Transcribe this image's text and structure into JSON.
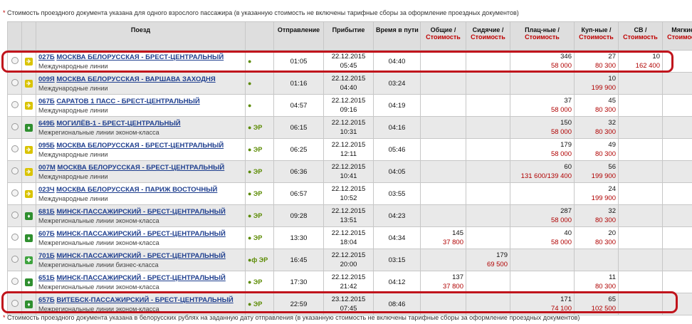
{
  "notes": {
    "top_star": "*",
    "top": "Стоимость проездного документа указана для одного взрослого пассажира (в указанную стоимость не включены тарифные сборы за оформление проездных документов)",
    "bottom_star": "*",
    "bottom": "Стоимость проездного документа указана в белорусских рублях на заданную дату отправления (в указанную стоимость не включены тарифные сборы за оформление проездных документов)"
  },
  "headers": {
    "train": "Поезд",
    "departure": "Отправление",
    "arrival": "Прибытие",
    "duration": "Время в пути",
    "common": "Общие /",
    "seated": "Сидячие /",
    "platz": "Плац-ные /",
    "coupe": "Куп-ные /",
    "sv": "СВ /",
    "soft": "Мягкие /",
    "cost": "Стоимость"
  },
  "colors": {
    "highlight": "#c0141c",
    "link": "#1f3f8f",
    "price": "#b00000"
  },
  "rows": [
    {
      "icon": "int",
      "num": "027Б",
      "name": "МОСКВА БЕЛОРУССКАЯ - БРЕСТ-ЦЕНТРАЛЬНЫЙ",
      "sub": "Международные линии",
      "svc": "●",
      "dep": "01:05",
      "arr_date": "22.12.2015",
      "arr_time": "05:45",
      "dur": "04:40",
      "common_s": "",
      "common_p": "",
      "seat_s": "",
      "seat_p": "",
      "platz_s": "346",
      "platz_p": "58 000",
      "coupe_s": "27",
      "coupe_p": "80 300",
      "sv_s": "10",
      "sv_p": "162 400",
      "soft_s": "",
      "soft_p": ""
    },
    {
      "icon": "int",
      "num": "009Я",
      "name": "МОСКВА БЕЛОРУССКАЯ - ВАРШАВА ЗАХОДНЯ",
      "sub": "Международные линии",
      "svc": "●",
      "dep": "01:16",
      "arr_date": "22.12.2015",
      "arr_time": "04:40",
      "dur": "03:24",
      "common_s": "",
      "common_p": "",
      "seat_s": "",
      "seat_p": "",
      "platz_s": "",
      "platz_p": "",
      "coupe_s": "10",
      "coupe_p": "199 900",
      "sv_s": "",
      "sv_p": "",
      "soft_s": "",
      "soft_p": ""
    },
    {
      "icon": "int",
      "num": "067Б",
      "name": "САРАТОВ 1 ПАСС - БРЕСТ-ЦЕНТРАЛЬНЫЙ",
      "sub": "Международные линии",
      "svc": "●",
      "dep": "04:57",
      "arr_date": "22.12.2015",
      "arr_time": "09:16",
      "dur": "04:19",
      "common_s": "",
      "common_p": "",
      "seat_s": "",
      "seat_p": "",
      "platz_s": "37",
      "platz_p": "58 000",
      "coupe_s": "45",
      "coupe_p": "80 300",
      "sv_s": "",
      "sv_p": "",
      "soft_s": "",
      "soft_p": ""
    },
    {
      "icon": "reg",
      "num": "649Б",
      "name": "МОГИЛЁВ-1 - БРЕСТ-ЦЕНТРАЛЬНЫЙ",
      "sub": "Межрегиональные линии эконом-класса",
      "svc": "● ЭР",
      "dep": "06:15",
      "arr_date": "22.12.2015",
      "arr_time": "10:31",
      "dur": "04:16",
      "common_s": "",
      "common_p": "",
      "seat_s": "",
      "seat_p": "",
      "platz_s": "150",
      "platz_p": "58 000",
      "coupe_s": "32",
      "coupe_p": "80 300",
      "sv_s": "",
      "sv_p": "",
      "soft_s": "",
      "soft_p": ""
    },
    {
      "icon": "int",
      "num": "095Б",
      "name": "МОСКВА БЕЛОРУССКАЯ - БРЕСТ-ЦЕНТРАЛЬНЫЙ",
      "sub": "Международные линии",
      "svc": "● ЭР",
      "dep": "06:25",
      "arr_date": "22.12.2015",
      "arr_time": "12:11",
      "dur": "05:46",
      "common_s": "",
      "common_p": "",
      "seat_s": "",
      "seat_p": "",
      "platz_s": "179",
      "platz_p": "58 000",
      "coupe_s": "49",
      "coupe_p": "80 300",
      "sv_s": "",
      "sv_p": "",
      "soft_s": "",
      "soft_p": ""
    },
    {
      "icon": "int",
      "num": "007М",
      "name": "МОСКВА БЕЛОРУССКАЯ - БРЕСТ-ЦЕНТРАЛЬНЫЙ",
      "sub": "Международные линии",
      "svc": "● ЭР",
      "dep": "06:36",
      "arr_date": "22.12.2015",
      "arr_time": "10:41",
      "dur": "04:05",
      "common_s": "",
      "common_p": "",
      "seat_s": "",
      "seat_p": "",
      "platz_s": "60",
      "platz_p": "131 600/139 400",
      "coupe_s": "56",
      "coupe_p": "199 900",
      "sv_s": "",
      "sv_p": "",
      "soft_s": "",
      "soft_p": ""
    },
    {
      "icon": "int",
      "num": "023Ч",
      "name": "МОСКВА БЕЛОРУССКАЯ - ПАРИЖ ВОСТОЧНЫЙ",
      "sub": "Международные линии",
      "svc": "● ЭР",
      "dep": "06:57",
      "arr_date": "22.12.2015",
      "arr_time": "10:52",
      "dur": "03:55",
      "common_s": "",
      "common_p": "",
      "seat_s": "",
      "seat_p": "",
      "platz_s": "",
      "platz_p": "",
      "coupe_s": "24",
      "coupe_p": "199 900",
      "sv_s": "",
      "sv_p": "",
      "soft_s": "",
      "soft_p": ""
    },
    {
      "icon": "reg",
      "num": "681Б",
      "name": "МИНСК-ПАССАЖИРСКИЙ - БРЕСТ-ЦЕНТРАЛЬНЫЙ",
      "sub": "Межрегиональные линии эконом-класса",
      "svc": "● ЭР",
      "dep": "09:28",
      "arr_date": "22.12.2015",
      "arr_time": "13:51",
      "dur": "04:23",
      "common_s": "",
      "common_p": "",
      "seat_s": "",
      "seat_p": "",
      "platz_s": "287",
      "platz_p": "58 000",
      "coupe_s": "32",
      "coupe_p": "80 300",
      "sv_s": "",
      "sv_p": "",
      "soft_s": "",
      "soft_p": ""
    },
    {
      "icon": "reg",
      "num": "607Б",
      "name": "МИНСК-ПАССАЖИРСКИЙ - БРЕСТ-ЦЕНТРАЛЬНЫЙ",
      "sub": "Межрегиональные линии эконом-класса",
      "svc": "● ЭР",
      "dep": "13:30",
      "arr_date": "22.12.2015",
      "arr_time": "18:04",
      "dur": "04:34",
      "common_s": "145",
      "common_p": "37 800",
      "seat_s": "",
      "seat_p": "",
      "platz_s": "40",
      "platz_p": "58 000",
      "coupe_s": "20",
      "coupe_p": "80 300",
      "sv_s": "",
      "sv_p": "",
      "soft_s": "",
      "soft_p": ""
    },
    {
      "icon": "biz",
      "num": "701Б",
      "name": "МИНСК-ПАССАЖИРСКИЙ - БРЕСТ-ЦЕНТРАЛЬНЫЙ",
      "sub": "Межрегиональные линии бизнес-класса",
      "svc": "●ф ЭР",
      "dep": "16:45",
      "arr_date": "22.12.2015",
      "arr_time": "20:00",
      "dur": "03:15",
      "common_s": "",
      "common_p": "",
      "seat_s": "179",
      "seat_p": "69 500",
      "platz_s": "",
      "platz_p": "",
      "coupe_s": "",
      "coupe_p": "",
      "sv_s": "",
      "sv_p": "",
      "soft_s": "",
      "soft_p": ""
    },
    {
      "icon": "reg",
      "num": "651Б",
      "name": "МИНСК-ПАССАЖИРСКИЙ - БРЕСТ-ЦЕНТРАЛЬНЫЙ",
      "sub": "Межрегиональные линии эконом-класса",
      "svc": "● ЭР",
      "dep": "17:30",
      "arr_date": "22.12.2015",
      "arr_time": "21:42",
      "dur": "04:12",
      "common_s": "137",
      "common_p": "37 800",
      "seat_s": "",
      "seat_p": "",
      "platz_s": "",
      "platz_p": "",
      "coupe_s": "11",
      "coupe_p": "80 300",
      "sv_s": "",
      "sv_p": "",
      "soft_s": "",
      "soft_p": ""
    },
    {
      "icon": "reg",
      "num": "657Б",
      "name": "ВИТЕБСК-ПАССАЖИРСКИЙ - БРЕСТ-ЦЕНТРАЛЬНЫЙ",
      "sub": "Межрегиональные линии эконом-класса",
      "svc": "● ЭР",
      "dep": "22:59",
      "arr_date": "23.12.2015",
      "arr_time": "07:45",
      "dur": "08:46",
      "common_s": "",
      "common_p": "",
      "seat_s": "",
      "seat_p": "",
      "platz_s": "171",
      "platz_p": "74 100",
      "coupe_s": "65",
      "coupe_p": "102 500",
      "sv_s": "",
      "sv_p": "",
      "soft_s": "",
      "soft_p": ""
    }
  ]
}
